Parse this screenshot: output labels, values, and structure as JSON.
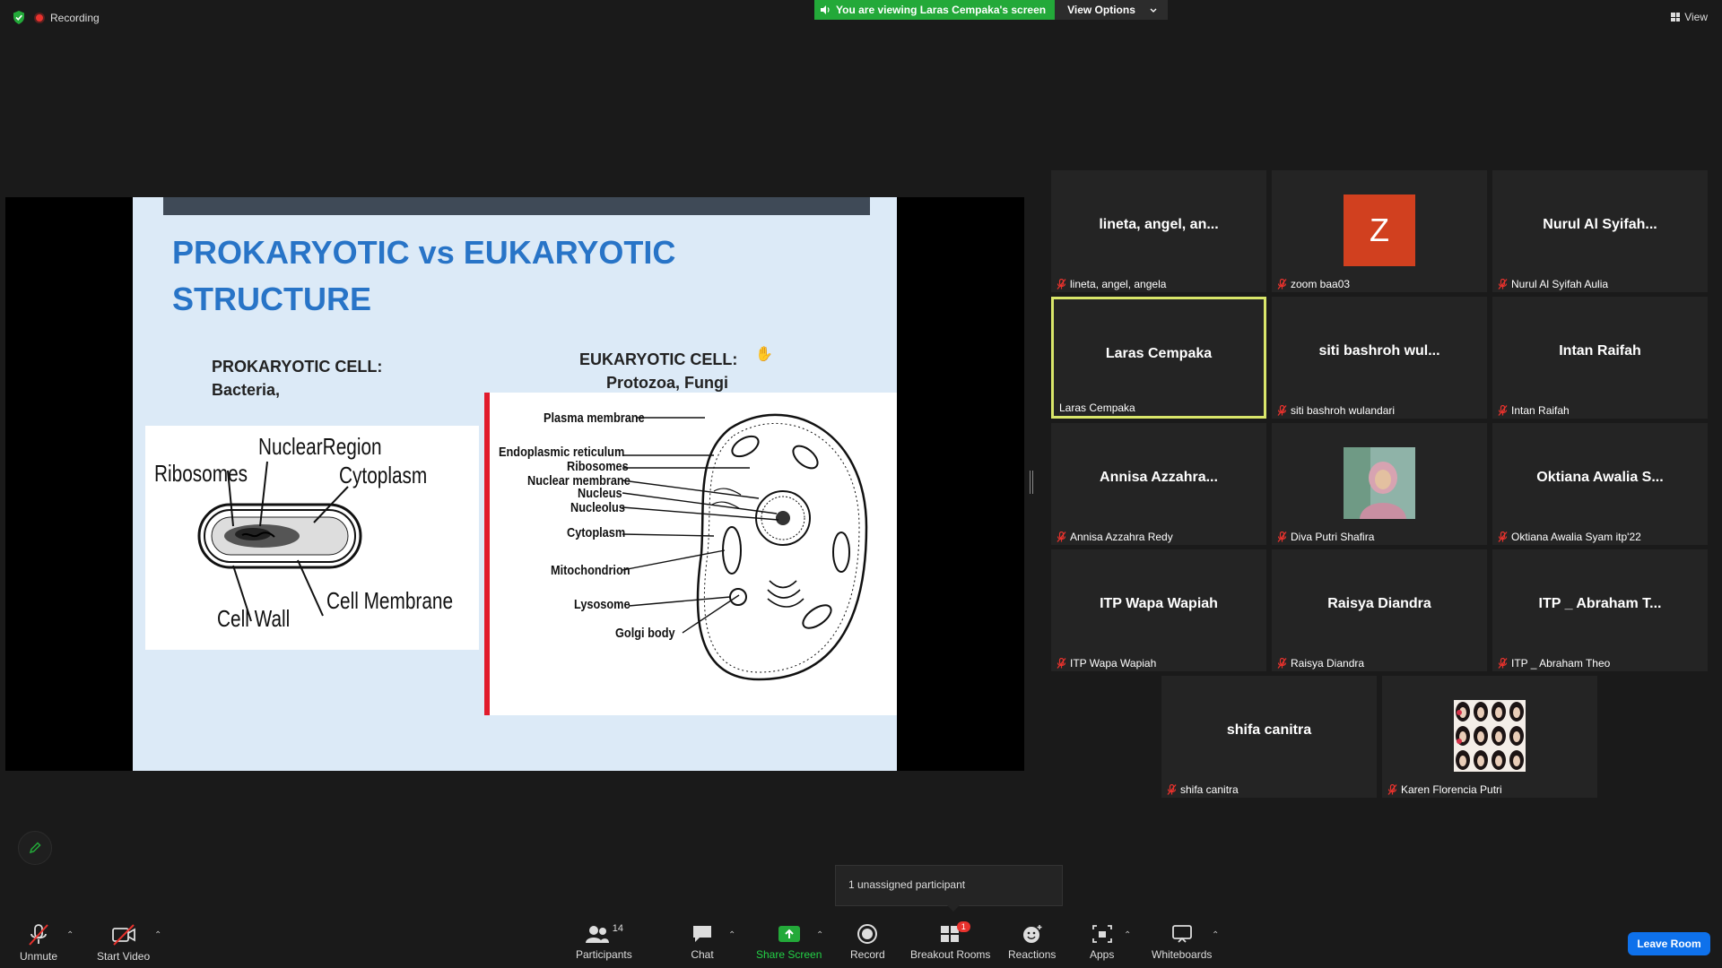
{
  "top": {
    "recording_label": "Recording",
    "viewing_text": "You are viewing Laras Cempaka's screen",
    "view_options_label": "View Options",
    "view_label": "View"
  },
  "slide": {
    "title_line1": "PROKARYOTIC vs EUKARYOTIC",
    "title_line2": "STRUCTURE",
    "prokaryotic_heading": "PROKARYOTIC CELL:",
    "prokaryotic_examples": "Bacteria,",
    "eukaryotic_heading": "EUKARYOTIC CELL:",
    "eukaryotic_examples": "Protozoa, Fungi",
    "prokaryotic_labels": {
      "nuclear_region": "NuclearRegion",
      "ribosomes": "Ribosomes",
      "cytoplasm": "Cytoplasm",
      "cell_membrane": "Cell Membrane",
      "cell_wall": "Cell Wall"
    },
    "eukaryotic_labels": {
      "plasma_membrane": "Plasma membrane",
      "endoplasmic_reticulum": "Endoplasmic reticulum",
      "ribosomes": "Ribosomes",
      "nuclear_membrane": "Nuclear membrane",
      "nucleus": "Nucleus",
      "nucleolus": "Nucleolus",
      "cytoplasm": "Cytoplasm",
      "mitochondrion": "Mitochondrion",
      "lysosome": "Lysosome",
      "golgi_body": "Golgi body"
    }
  },
  "participants": [
    {
      "display": "lineta, angel, an...",
      "label": "lineta, angel, angela",
      "type": "name",
      "muted": true
    },
    {
      "display": "Z",
      "label": "zoom baa03",
      "type": "avatar",
      "muted": true
    },
    {
      "display": "Nurul Al Syifah...",
      "label": "Nurul Al Syifah Aulia",
      "type": "name",
      "muted": true
    },
    {
      "display": "Laras Cempaka",
      "label": "Laras Cempaka",
      "type": "name",
      "muted": false,
      "active": true
    },
    {
      "display": "siti bashroh wul...",
      "label": "siti bashroh wulandari",
      "type": "name",
      "muted": true
    },
    {
      "display": "Intan Raifah",
      "label": "Intan Raifah",
      "type": "name",
      "muted": true
    },
    {
      "display": "Annisa Azzahra...",
      "label": "Annisa Azzahra Redy",
      "type": "name",
      "muted": true
    },
    {
      "display": "",
      "label": "Diva Putri Shafira",
      "type": "photo",
      "muted": true
    },
    {
      "display": "Oktiana Awalia S...",
      "label": "Oktiana Awalia Syam itp'22",
      "type": "name",
      "muted": true
    },
    {
      "display": "ITP Wapa Wapiah",
      "label": "ITP Wapa Wapiah",
      "type": "name",
      "muted": true
    },
    {
      "display": "Raisya Diandra",
      "label": "Raisya Diandra",
      "type": "name",
      "muted": true
    },
    {
      "display": "ITP _ Abraham T...",
      "label": "ITP _ Abraham Theo",
      "type": "name",
      "muted": true
    },
    {
      "display": "shifa canitra",
      "label": "shifa canitra",
      "type": "name",
      "muted": true
    },
    {
      "display": "",
      "label": "Karen Florencia Putri",
      "type": "photo",
      "muted": true
    }
  ],
  "popup": {
    "unassigned_text": "1 unassigned participant"
  },
  "toolbar": {
    "unmute": "Unmute",
    "start_video": "Start Video",
    "participants": "Participants",
    "participants_count": "14",
    "chat": "Chat",
    "share_screen": "Share Screen",
    "record": "Record",
    "breakout_rooms": "Breakout Rooms",
    "breakout_badge": "1",
    "reactions": "Reactions",
    "apps": "Apps",
    "whiteboards": "Whiteboards",
    "leave_room": "Leave Room"
  },
  "colors": {
    "accent_green": "#23a939",
    "leave_blue": "#0e71eb",
    "active_speaker": "#d9e66a",
    "slide_title": "#2874c7",
    "avatar_z": "#d1401f"
  }
}
